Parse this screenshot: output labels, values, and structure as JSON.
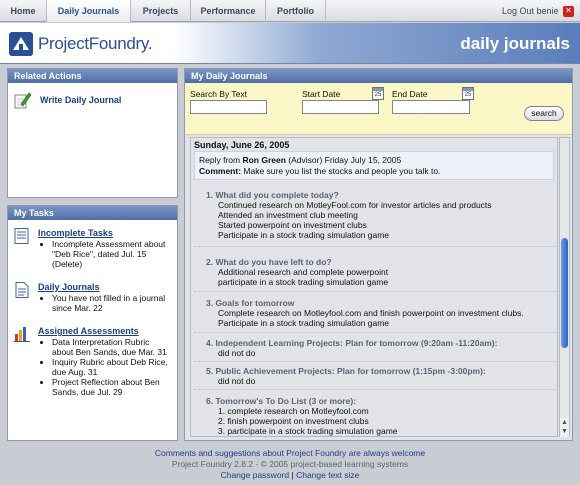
{
  "nav": {
    "items": [
      "Home",
      "Daily Journals",
      "Projects",
      "Performance",
      "Portfolio"
    ],
    "active": "Daily Journals",
    "logout": "Log Out benie"
  },
  "banner": {
    "logo_text": "ProjectFoundry.",
    "title": "daily journals"
  },
  "related_actions": {
    "title": "Related Actions",
    "link": "Write Daily Journal"
  },
  "my_tasks": {
    "title": "My Tasks",
    "groups": [
      {
        "title": "Incomplete Tasks",
        "items": [
          "Incomplete Assessment about \"Deb Rice\", dated Jul. 15 (Delete)"
        ]
      },
      {
        "title": "Daily Journals",
        "items": [
          "You have not filled in a journal since Mar. 22"
        ]
      },
      {
        "title": "Assigned Assessments",
        "items": [
          "Data Interpretation Rubric about Ben Sands, due Mar. 31",
          "Inquiry Rubric about Deb Rice, due Aug. 31",
          "Project Reflection about Ben Sands, due Jul. 29"
        ]
      }
    ]
  },
  "journals": {
    "title": "My Daily Journals",
    "search_label": "Search By Text",
    "start_label": "Start Date",
    "end_label": "End Date",
    "calendar_day": "25",
    "search_button": "search",
    "date": "Sunday, June 26, 2005",
    "reply_prefix": "Reply from ",
    "reply_name": "Ron Green",
    "reply_suffix": " (Advisor) Friday July 15, 2005",
    "comment_label": "Comment:",
    "comment_text": " Make sure you list the stocks and people you talk to.",
    "questions": [
      {
        "q": "1.  What did you complete today?",
        "answers": [
          "Continued research on MotleyFool.com for investor articles and products",
          "Attended an investment club meeting",
          "Started powerpoint on investment clubs",
          "Participate in a stock trading simulation game"
        ]
      },
      {
        "q": "2.  What do you have left to do?",
        "answers": [
          "Additional research and complete powerpoint",
          "participate in a stock trading simulation game"
        ]
      },
      {
        "q": "3.  Goals for tomorrow",
        "answers": [
          "Complete research on Motleyfool.com and finish powerpoint on investment clubs.",
          "Participate in a stock trading simulation game"
        ]
      },
      {
        "q": "4.  Independent Learning Projects: Plan for tomorrow (9:20am -11:20am):",
        "answers": [
          "did not do"
        ]
      },
      {
        "q": "5.  Public Achievement Projects: Plan for tomorrow (1:15pm -3:00pm):",
        "answers": [
          "did not do"
        ]
      },
      {
        "q": "6.  Tomorrow's To Do List (3 or more):",
        "answers": [
          "1.  complete research on Motleyfool.com",
          "2.  finish powerpoint on investment clubs",
          "3.  participate in a stock trading simulation game"
        ]
      }
    ]
  },
  "footer": {
    "line1": "Comments and suggestions about Project Foundry are always welcome",
    "line2": "Project Foundry 2.8.2 - © 2005 project-based learning systems",
    "change_password": "Change password",
    "separator": "|",
    "change_text_size": "Change text size"
  }
}
